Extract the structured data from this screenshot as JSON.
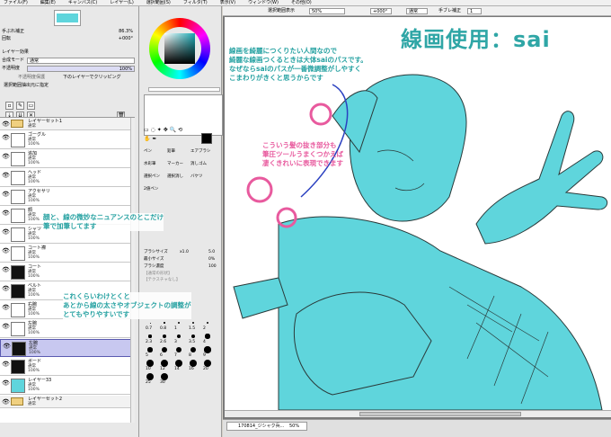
{
  "menubar": {
    "items": [
      "ファイル(F)",
      "編集(E)",
      "キャンバス(C)",
      "レイヤー(L)",
      "選択範囲(S)",
      "フィルタ(T)",
      "表示(V)",
      "ウィンドウ(W)",
      "その他(O)"
    ]
  },
  "left_panel": {
    "hand_prop": "手ぶれ補正",
    "hand_val": "86.3%",
    "angle_label": "回転",
    "angle_val": "+000°",
    "layer_effect": "レイヤー効果",
    "mode_label": "合成モード",
    "mode_val": "通常",
    "opacity_label": "不透明度",
    "opacity_val": "100%",
    "clip_label": "下のレイヤーでクリッピング",
    "protect_label": "不透明度保護",
    "sel_source": "選択範囲抽出元に指定"
  },
  "layers": [
    {
      "name": "レイヤーセット1",
      "mode": "通常",
      "opacity": "100%",
      "type": "folder"
    },
    {
      "name": "ゴーグル",
      "mode": "通常",
      "opacity": "100%",
      "type": "layer"
    },
    {
      "name": "追加",
      "mode": "通常",
      "opacity": "100%",
      "type": "layer"
    },
    {
      "name": "ヘッド",
      "mode": "通常",
      "opacity": "100%",
      "type": "layer"
    },
    {
      "name": "アクセサリ",
      "mode": "通常",
      "opacity": "100%",
      "type": "layer"
    },
    {
      "name": "顔",
      "mode": "通常",
      "opacity": "100%",
      "type": "layer"
    },
    {
      "name": "シャツ",
      "mode": "通常",
      "opacity": "100%",
      "type": "layer"
    },
    {
      "name": "コート襟",
      "mode": "通常",
      "opacity": "100%",
      "type": "layer"
    },
    {
      "name": "コート",
      "mode": "通常",
      "opacity": "100%",
      "type": "layer"
    },
    {
      "name": "ベルト",
      "mode": "通常",
      "opacity": "100%",
      "type": "layer"
    },
    {
      "name": "右腕",
      "mode": "通常",
      "opacity": "100%",
      "type": "layer"
    },
    {
      "name": "左腕",
      "mode": "通常",
      "opacity": "100%",
      "type": "layer"
    },
    {
      "name": "左腕",
      "mode": "通常",
      "opacity": "100%",
      "type": "layer",
      "selected": true
    },
    {
      "name": "ボード",
      "mode": "通常",
      "opacity": "100%",
      "type": "layer"
    },
    {
      "name": "レイヤー33",
      "mode": "通常",
      "opacity": "100%",
      "type": "layer"
    },
    {
      "name": "レイヤーセット2",
      "mode": "通常",
      "opacity": "100%",
      "type": "folder"
    }
  ],
  "tool_panel": {
    "tool_tabs": [
      "ペン",
      "鉛筆",
      "エアブラシ",
      "水彩筆",
      "マーカー",
      "消しゴム",
      "選択ペン",
      "選択消し",
      "バケツ",
      "2値ペン"
    ],
    "brush_size_label": "ブラシサイズ",
    "brush_size_mult": "x1.0",
    "brush_size_val": "5.0",
    "min_size_label": "最小サイズ",
    "min_size_val": "0%",
    "density_label": "ブラシ濃度",
    "density_val": "100",
    "texture_label": "【通常の形状】",
    "texture2_label": "【テクスチャなし】",
    "size_presets": [
      "0.7",
      "0.8",
      "1",
      "1.5",
      "2",
      "2.3",
      "2.6",
      "3",
      "3.5",
      "4",
      "5",
      "6",
      "7",
      "8",
      "9",
      "10",
      "12",
      "14",
      "16",
      "20",
      "25",
      "30"
    ]
  },
  "canvas_toolbar": {
    "sel_view": "選択範囲表示",
    "zoom": "50%",
    "angle": "+000°",
    "mode": "通常",
    "stab_label": "手ブレ補正",
    "stab_val": "1"
  },
  "status": {
    "tab_label": "170814_ジシャク兵...",
    "tab_zoom": "50%"
  },
  "overlay": {
    "title": "線画使用：sai",
    "note1": [
      "線画を綺麗につくりたい人間なので",
      "綺麗な線画つくるときは大体saiのパスです。",
      "なぜならsaiのパスが一番微調整がしやすく",
      "こまわりがきくと思うからです"
    ],
    "note2": [
      "こういう髪の抜き部分も",
      "筆圧ツールうまくつかえば",
      "凄くきれいに表現できます"
    ],
    "note3": [
      "顔と、線の微妙なニュアンスのとこだけ",
      "筆で加筆してます"
    ],
    "note4": [
      "これくらいわけとくと",
      "あとから線の太さやオブジェクトの調整が",
      "とてもやりやすいです"
    ]
  },
  "colors": {
    "line_art": "#5fd5dc",
    "teal_note": "#27a2a2",
    "pink_note": "#e85a9e",
    "selected_layer": "#c8c8f0"
  }
}
